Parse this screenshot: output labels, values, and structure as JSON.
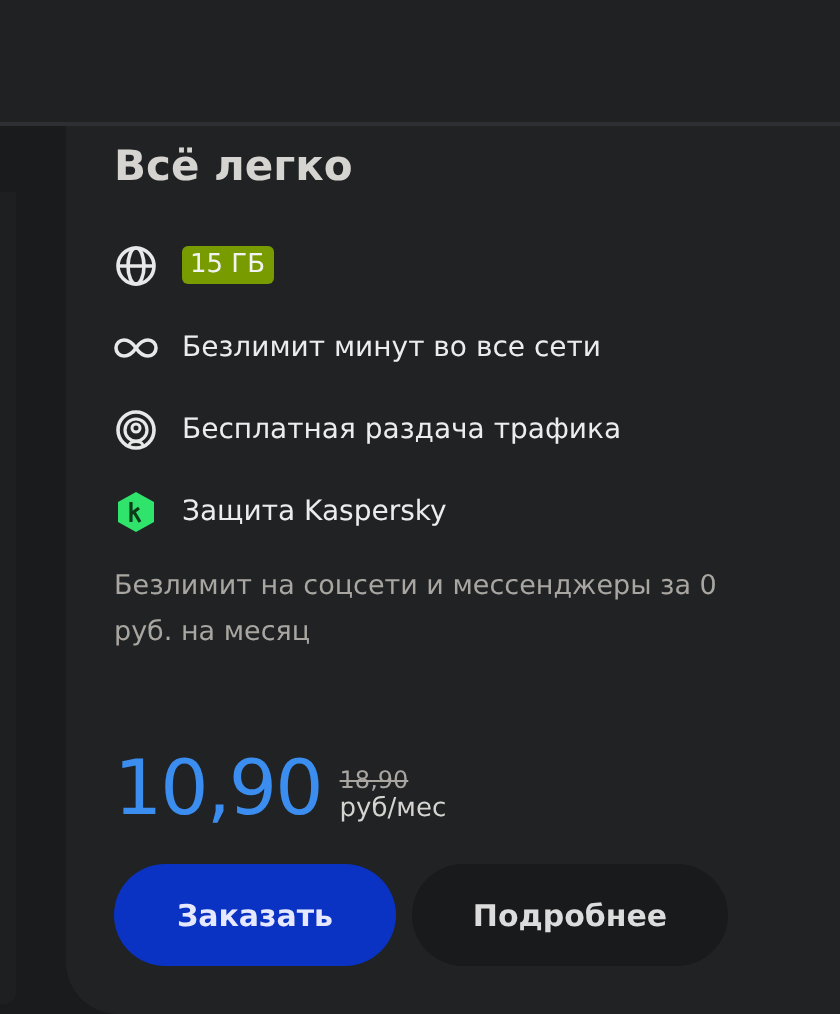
{
  "plan": {
    "title": "Всё легко",
    "features": [
      {
        "kind": "badge",
        "text": "15 ГБ"
      },
      {
        "kind": "text",
        "text": "Безлимит минут во все сети"
      },
      {
        "kind": "text",
        "text": "Бесплатная раздача трафика"
      },
      {
        "kind": "text",
        "text": "Защита Kaspersky"
      }
    ],
    "description": "Безлимит на соцсети и мессенджеры за 0 руб. на месяц",
    "price": "10,90",
    "old_price": "18,90",
    "unit": "руб/мес",
    "buttons": [
      {
        "kind": "primary",
        "label": "Заказать"
      },
      {
        "kind": "secondary",
        "label": "Подробнее"
      }
    ]
  }
}
